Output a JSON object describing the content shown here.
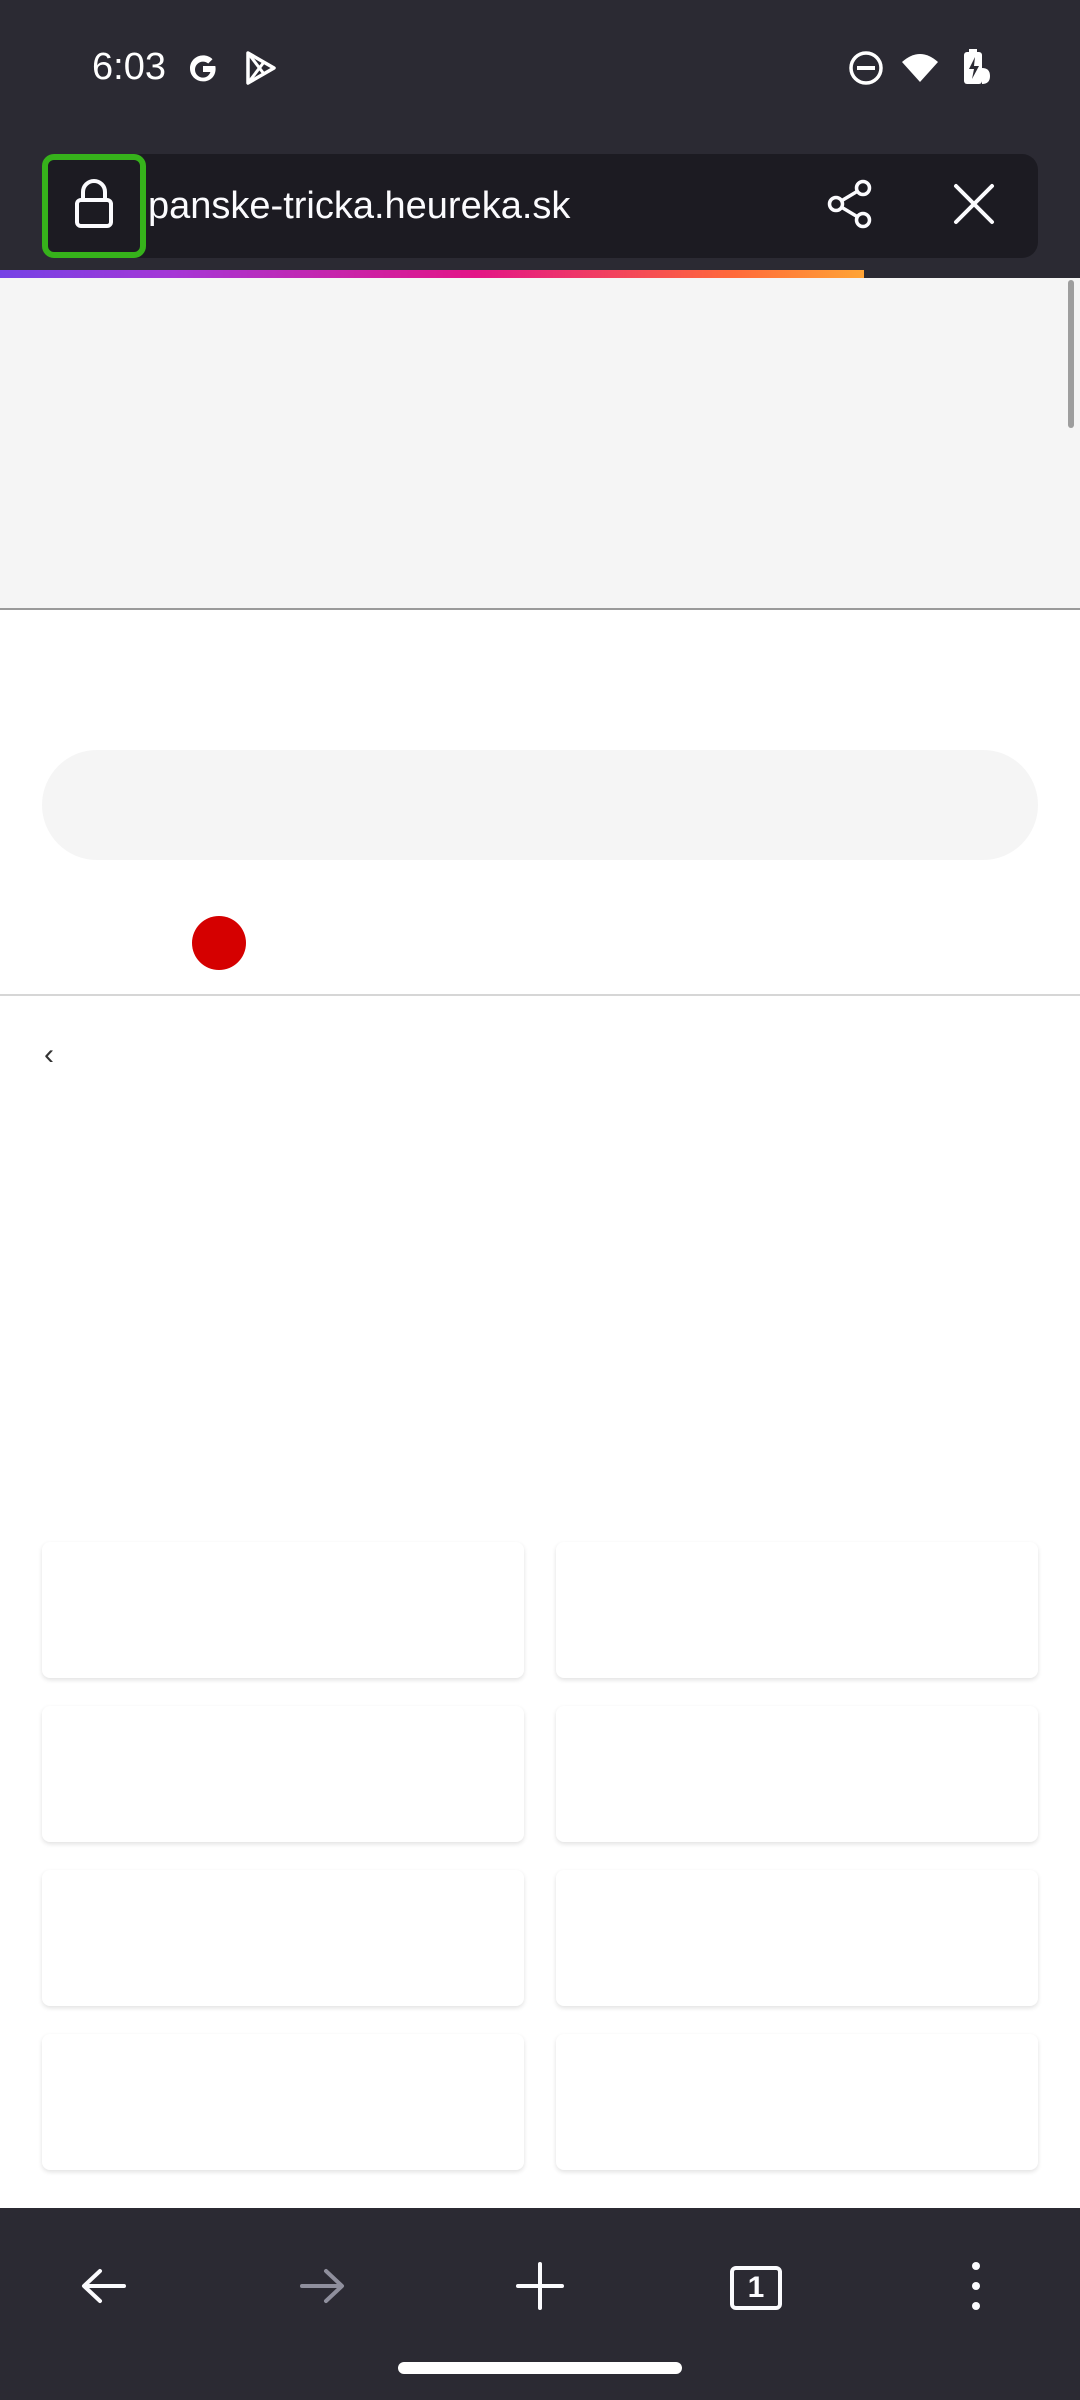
{
  "status_bar": {
    "time": "6:03",
    "left_icons": [
      "google-g-icon",
      "play-store-icon"
    ],
    "right_icons": [
      "do-not-disturb-icon",
      "wifi-icon",
      "battery-charging-icon"
    ]
  },
  "toolbar": {
    "url": "panske-tricka.heureka.sk",
    "lock_icon": "lock-icon",
    "share_icon": "share-icon",
    "close_icon": "close-icon",
    "load_progress": 0.8,
    "accent_color": "#36b21b"
  },
  "page": {
    "back_chevron": "‹",
    "placeholder_cards": 8,
    "brand_dot_color": "#d50000"
  },
  "bottom_nav": {
    "back_icon": "arrow-left-icon",
    "forward_icon": "arrow-right-icon",
    "new_tab_icon": "plus-icon",
    "tab_count": "1",
    "menu_icon": "more-vertical-icon"
  }
}
